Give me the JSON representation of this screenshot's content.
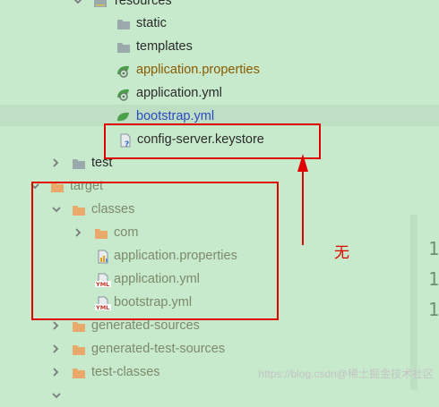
{
  "tree": {
    "resources_label": "resources",
    "static_label": "static",
    "templates_label": "templates",
    "src_app_props_label": "application.properties",
    "src_app_yml_label": "application.yml",
    "src_bootstrap_label": "bootstrap.yml",
    "keystore_label": "config-server.keystore",
    "test_label": "test",
    "target_label": "target",
    "classes_label": "classes",
    "com_label": "com",
    "cls_app_props_label": "application.properties",
    "cls_app_yml_label": "application.yml",
    "cls_bootstrap_label": "bootstrap.yml",
    "generated_sources_label": "generated-sources",
    "generated_test_sources_label": "generated-test-sources",
    "test_classes_label": "test-classes"
  },
  "annotation": {
    "missing_label": "无"
  },
  "gutter": {
    "line_numbers": [
      "1",
      "1",
      "1"
    ]
  },
  "watermark": {
    "text": "https://blog.csdn@稀土掘金技术社区"
  },
  "colors": {
    "background": "#c7e9cc",
    "selected_row": "#bedfc4",
    "text_default": "#2b2b2b",
    "text_modified": "#8a5a00",
    "text_new": "#2a48c4",
    "text_target": "#7d8a6a",
    "folder_orange": "#e8a96a",
    "folder_gray": "#9aa9ac",
    "annotation_red": "#e00000"
  },
  "icons": {
    "folder": "folder-icon",
    "spring_config": "spring-leaf-icon",
    "unknown_file": "unknown-file-icon",
    "properties_file": "properties-file-icon",
    "yml_file": "yml-file-icon",
    "chevron_right": "chevron-right-icon",
    "chevron_down": "chevron-down-icon"
  }
}
